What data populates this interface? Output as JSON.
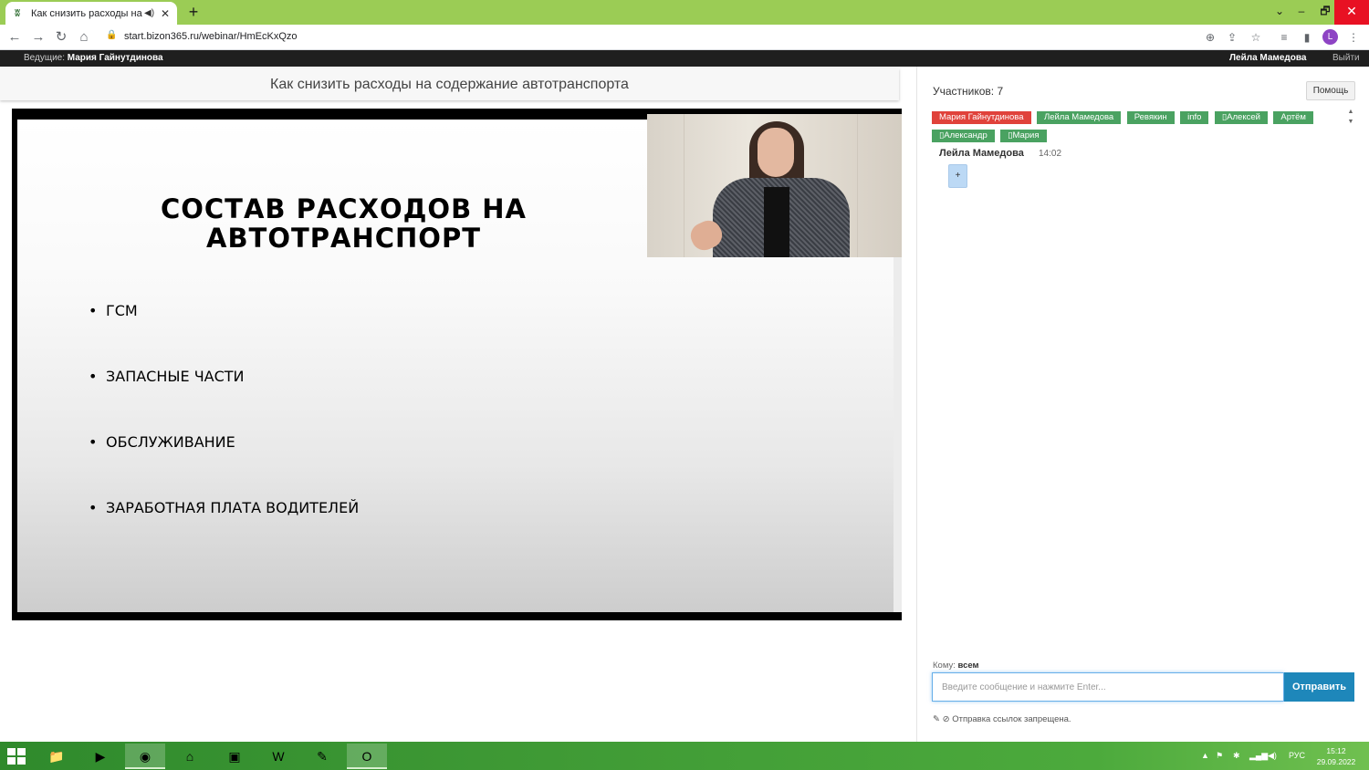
{
  "browser": {
    "tab_title": "Как снизить расходы на содержание автотранспорта",
    "new_tab_symbol": "+",
    "url": "start.bizon365.ru/webinar/HmEcKxQzo",
    "profile_initial": "L",
    "window_minimize": "⌄",
    "window_restore": "🗗",
    "window_close": "✕"
  },
  "webinar": {
    "host_label": "Ведущие:",
    "host_name": "Мария Гайнутдинова",
    "current_user": "Лейла Мамедова",
    "logout": "Выйти",
    "title": "Как снизить расходы на содержание автотранспорта"
  },
  "slide": {
    "heading_line1": "СОСТАВ РАСХОДОВ НА",
    "heading_line2": "АВТОТРАНСПОРТ",
    "bullets": [
      "ГСМ",
      "ЗАПАСНЫЕ ЧАСТИ",
      "ОБСЛУЖИВАНИЕ",
      "ЗАРАБОТНАЯ ПЛАТА ВОДИТЕЛЕЙ"
    ],
    "bullet_symbol": "•"
  },
  "chat": {
    "participants_label": "Участников: 7",
    "help_button": "Помощь",
    "participants": [
      {
        "name": "Мария Гайнутдинова",
        "color": "#e0423b"
      },
      {
        "name": "Лейла Мамедова",
        "color": "#4aa261"
      },
      {
        "name": "Ревякин",
        "color": "#4aa261"
      },
      {
        "name": "info",
        "color": "#4aa261"
      },
      {
        "name": "▯Алексей",
        "color": "#4aa261"
      },
      {
        "name": "Артём",
        "color": "#4aa261"
      },
      {
        "name": "▯Александр",
        "color": "#4aa261"
      },
      {
        "name": "▯Мария",
        "color": "#4aa261"
      }
    ],
    "message": {
      "author": "Лейла Мамедова",
      "time": "14:02",
      "content": "+"
    },
    "to_label": "Кому:",
    "to_value": "всем",
    "input_placeholder": "Введите сообщение и нажмите Enter...",
    "send_button": "Отправить",
    "links_note": "✎ ⊘ Отправка ссылок запрещена."
  },
  "taskbar": {
    "language": "РУС",
    "time": "15:12",
    "date": "29.09.2022"
  },
  "colors": {
    "tabstrip": "#9bcc55",
    "send_button": "#1e87ba",
    "host_chip": "#e0423b",
    "guest_chip": "#4aa261"
  }
}
